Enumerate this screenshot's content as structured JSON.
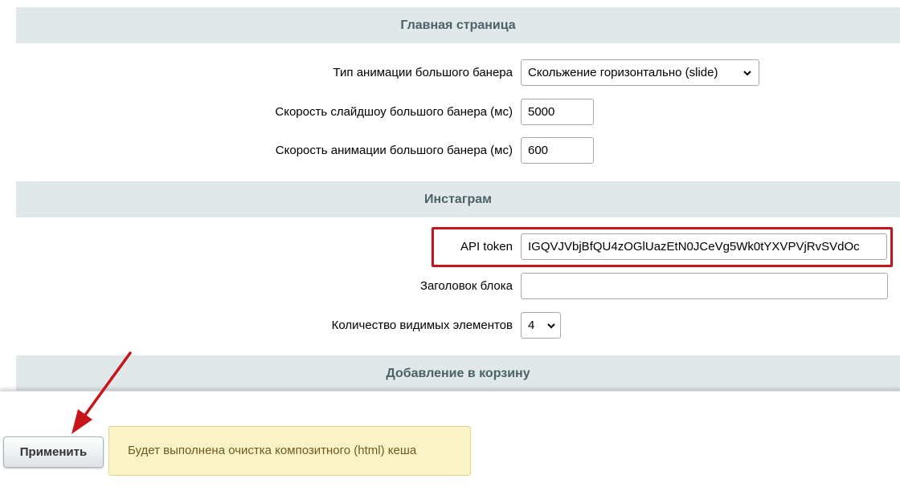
{
  "sections": {
    "main_page": {
      "title": "Главная страница",
      "banner_animation_type": {
        "label": "Тип анимации большого банера",
        "value": "Скольжение горизонтально (slide)"
      },
      "banner_slideshow_speed": {
        "label": "Скорость слайдшоу большого банера (мс)",
        "value": "5000"
      },
      "banner_animation_speed": {
        "label": "Скорость анимации большого банера (мс)",
        "value": "600"
      }
    },
    "instagram": {
      "title": "Инстаграм",
      "api_token": {
        "label": "API token",
        "value": "IGQVJVbjBfQU4zOGlUazEtN0JCeVg5Wk0tYXVPVjRvSVdOc"
      },
      "block_title": {
        "label": "Заголовок блока",
        "value": ""
      },
      "visible_count": {
        "label": "Количество видимых элементов",
        "value": "4"
      }
    },
    "add_to_cart": {
      "title": "Добавление в корзину"
    }
  },
  "footer": {
    "apply_label": "Применить",
    "notice_text": "Будет выполнена очистка композитного (html) кеша"
  },
  "colors": {
    "section_header_bg": "#e0e8ea",
    "highlight": "#c7141b",
    "notice_bg": "#fbf3c8"
  }
}
